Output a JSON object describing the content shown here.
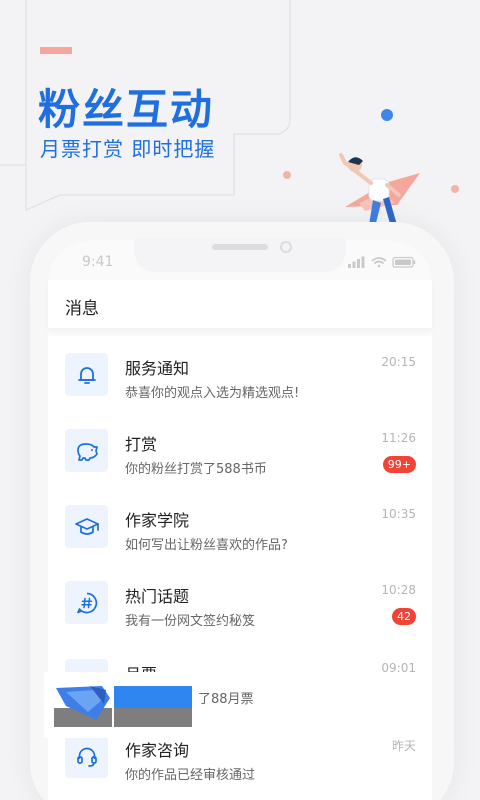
{
  "promo": {
    "headline": "粉丝互动",
    "subline": "月票打赏 即时把握"
  },
  "colors": {
    "brand_blue": "#1f6fde",
    "accent_pink": "#f4a79a",
    "badge_red": "#f04437",
    "icon_bg": "#eef4fd"
  },
  "status_bar": {
    "time": "9:41"
  },
  "app": {
    "title": "消息"
  },
  "messages": [
    {
      "icon": "bell-icon",
      "title": "服务通知",
      "desc": "恭喜你的观点入选为精选观点!",
      "time": "20:15",
      "badge": ""
    },
    {
      "icon": "piggy-bank-icon",
      "title": "打赏",
      "desc": "你的粉丝打赏了588书币",
      "time": "11:26",
      "badge": "99+"
    },
    {
      "icon": "graduation-cap-icon",
      "title": "作家学院",
      "desc": "如何写出让粉丝喜欢的作品?",
      "time": "10:35",
      "badge": ""
    },
    {
      "icon": "hashtag-icon",
      "title": "热门话题",
      "desc": "我有一份网文签约秘笈",
      "time": "10:28",
      "badge": "42"
    },
    {
      "icon": "ticket-icon",
      "title": "月票",
      "desc": "了88月票",
      "time": "09:01",
      "badge": ""
    },
    {
      "icon": "headset-icon",
      "title": "作家咨询",
      "desc": "你的作品已经审核通过",
      "time": "昨天",
      "badge": ""
    }
  ]
}
